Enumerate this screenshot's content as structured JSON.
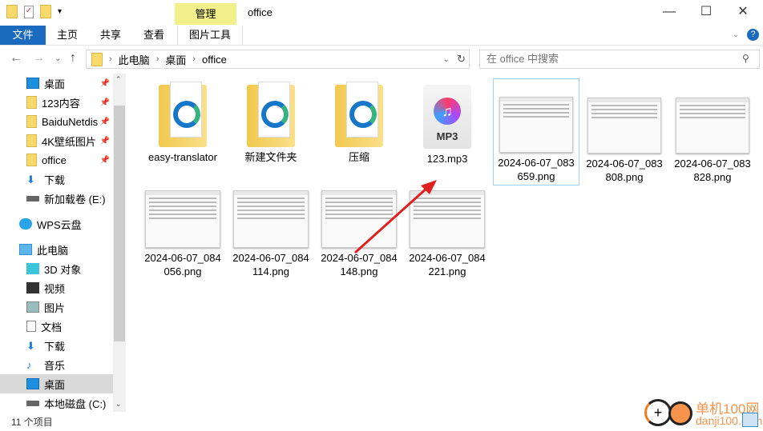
{
  "title_bar": {
    "title": "office",
    "context_tab": "管理",
    "minimize": "—",
    "maximize": "☐",
    "close": "✕"
  },
  "ribbon": {
    "tabs": [
      "文件",
      "主页",
      "共享",
      "查看",
      "图片工具"
    ],
    "help_icon": "?"
  },
  "address": {
    "path": [
      "此电脑",
      "桌面",
      "office"
    ],
    "search_placeholder": "在 office 中搜索"
  },
  "nav": {
    "items": [
      {
        "label": "桌面",
        "icon": "desktop-icon",
        "pinned": true
      },
      {
        "label": "123内容",
        "icon": "folder-icon",
        "pinned": true
      },
      {
        "label": "BaiduNetdis",
        "icon": "folder-icon",
        "pinned": true
      },
      {
        "label": "4K壁纸图片",
        "icon": "folder-icon",
        "pinned": true
      },
      {
        "label": "office",
        "icon": "folder-icon",
        "pinned": true
      },
      {
        "label": "下载",
        "icon": "download-icon"
      },
      {
        "label": "新加载卷 (E:)",
        "icon": "drive-icon"
      },
      {
        "label": "WPS云盘",
        "icon": "cloud-icon"
      },
      {
        "label": "此电脑",
        "icon": "computer-icon"
      },
      {
        "label": "3D 对象",
        "icon": "cube-icon"
      },
      {
        "label": "视频",
        "icon": "video-icon"
      },
      {
        "label": "图片",
        "icon": "picture-icon"
      },
      {
        "label": "文档",
        "icon": "document-icon"
      },
      {
        "label": "下载",
        "icon": "download-icon"
      },
      {
        "label": "音乐",
        "icon": "music-icon"
      },
      {
        "label": "桌面",
        "icon": "desktop-icon",
        "selected": true
      },
      {
        "label": "本地磁盘 (C:)",
        "icon": "drive-icon"
      }
    ]
  },
  "files": [
    {
      "name": "easy-translator",
      "type": "folder"
    },
    {
      "name": "新建文件夹",
      "type": "folder"
    },
    {
      "name": "压缩",
      "type": "folder"
    },
    {
      "name": "123.mp3",
      "type": "mp3",
      "badge": "MP3"
    },
    {
      "name": "2024-06-07_083659.png",
      "type": "png",
      "selected": true
    },
    {
      "name": "2024-06-07_083808.png",
      "type": "png"
    },
    {
      "name": "2024-06-07_083828.png",
      "type": "png"
    },
    {
      "name": "2024-06-07_084056.png",
      "type": "png"
    },
    {
      "name": "2024-06-07_084114.png",
      "type": "png"
    },
    {
      "name": "2024-06-07_084148.png",
      "type": "png"
    },
    {
      "name": "2024-06-07_084221.png",
      "type": "png"
    }
  ],
  "status": {
    "count": "11 个项目"
  },
  "watermark": {
    "text": "单机100网",
    "url_text": "danji100.com"
  },
  "colors": {
    "accent": "#1a6ac0",
    "manage_tab": "#f2f08a",
    "selection": "#d9d9d9",
    "arrow": "#e02020"
  }
}
